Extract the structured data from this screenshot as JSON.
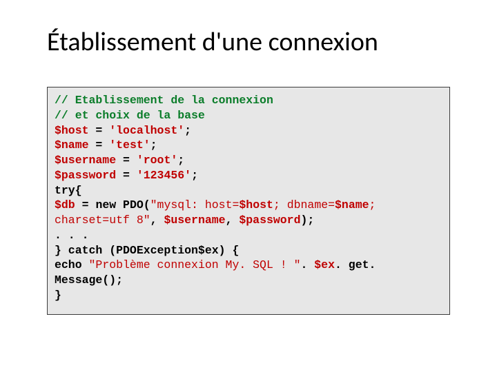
{
  "title": "Établissement d'une connexion",
  "code": {
    "c1": "// Etablissement de la connexion",
    "c2": "// et choix de la base",
    "l3a": "$host",
    "l3b": " = ",
    "l3c": "'localhost'",
    "l3d": ";",
    "l4a": "$name",
    "l4b": " = ",
    "l4c": "'test'",
    "l4d": ";",
    "l5a": "$username",
    "l5b": " = ",
    "l5c": "'root'",
    "l5d": ";",
    "l6a": "$password",
    "l6b": " = ",
    "l6c": "'123456'",
    "l6d": ";",
    "l7": "try{",
    "l8a": "$db",
    "l8b": " = ",
    "l8c": "new PDO",
    "l8d": "(",
    "l8e": "\"mysql: host=",
    "l8f": "$host",
    "l8g": "; dbname=",
    "l8h": "$name",
    "l8i": ";",
    "l9a": "charset=utf 8\"",
    "l9b": ", ",
    "l9c": "$username",
    "l9d": ", ",
    "l9e": "$password",
    "l9f": ");",
    "l10": ". . .",
    "l11": "} catch (PDOException$ex) {",
    "l12a": "  echo ",
    "l12b": "\"Problème connexion My. SQL ! \"",
    "l12c": ". ",
    "l12d": "$ex",
    "l12e": ". get. Message();",
    "l13": "}"
  }
}
